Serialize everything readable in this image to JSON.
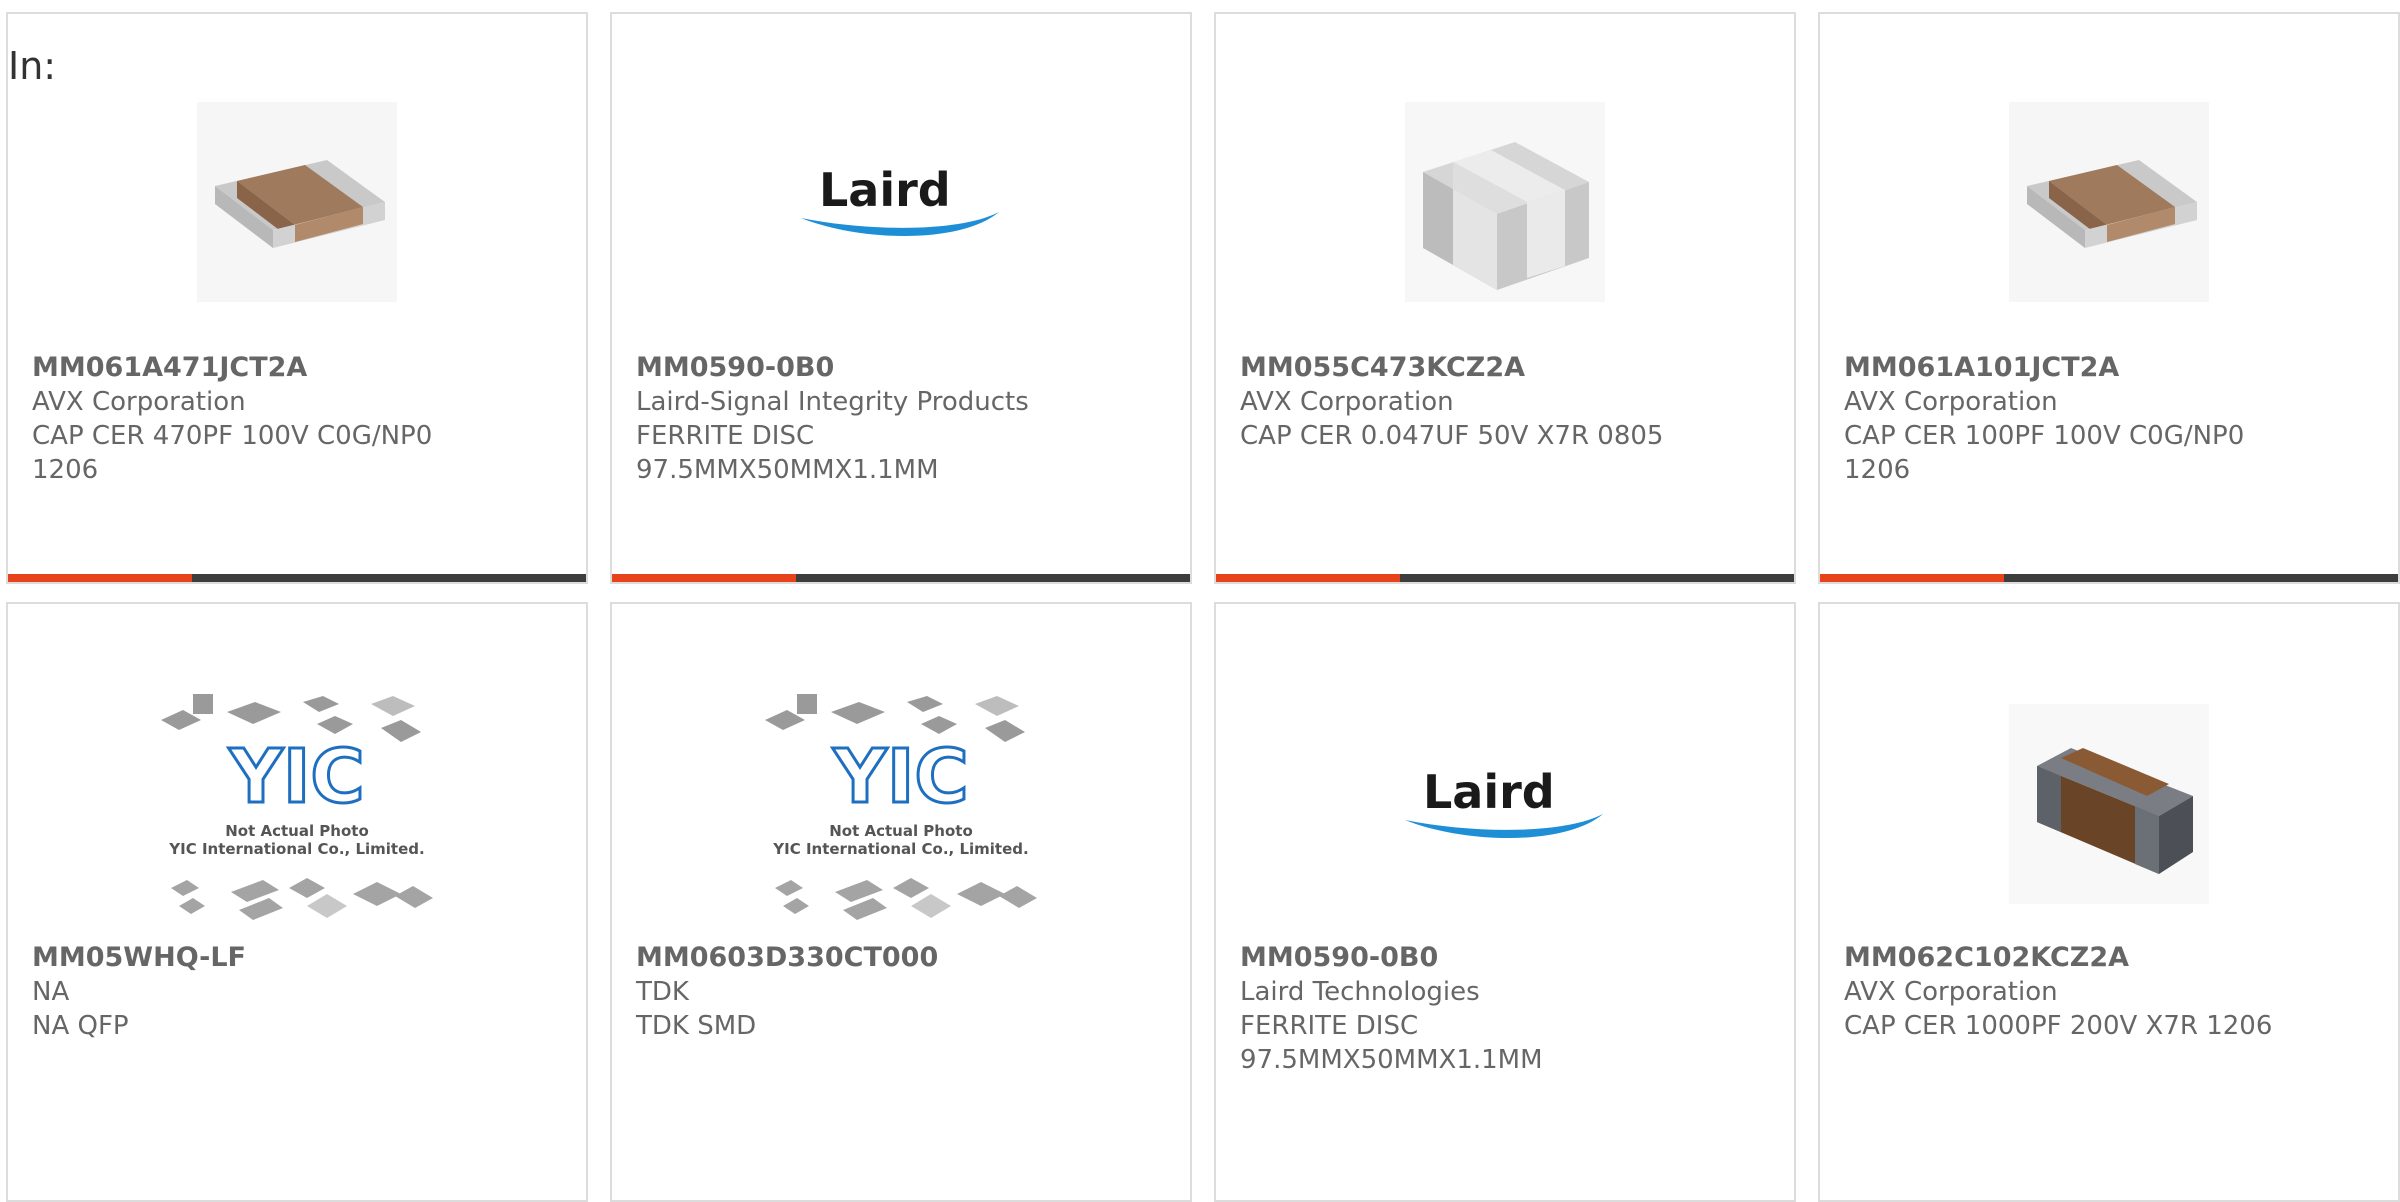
{
  "header": {
    "in_label": "In:"
  },
  "products": [
    {
      "part_number": "MM061A471JCT2A",
      "manufacturer": "AVX Corporation",
      "description_line1": "CAP CER 470PF 100V C0G/NP0",
      "description_line2": "1206",
      "image": "ceramic-capacitor-chip-image"
    },
    {
      "part_number": "MM0590-0B0",
      "manufacturer": "Laird-Signal Integrity Products",
      "description_line1": "FERRITE DISC",
      "description_line2": "97.5MMX50MMX1.1MM",
      "image": "laird-logo"
    },
    {
      "part_number": "MM055C473KCZ2A",
      "manufacturer": "AVX Corporation",
      "description_line1": "CAP CER 0.047UF 50V X7R 0805",
      "description_line2": "",
      "image": "ceramic-capacitor-white-image"
    },
    {
      "part_number": "MM061A101JCT2A",
      "manufacturer": "AVX Corporation",
      "description_line1": "CAP CER 100PF 100V C0G/NP0",
      "description_line2": "1206",
      "image": "ceramic-capacitor-chip-image"
    },
    {
      "part_number": "MM05WHQ-LF",
      "manufacturer": "NA",
      "description_line1": "NA QFP",
      "description_line2": "",
      "image": "yic-placeholder-image"
    },
    {
      "part_number": "MM0603D330CT000",
      "manufacturer": "TDK",
      "description_line1": "TDK SMD",
      "description_line2": "",
      "image": "yic-placeholder-image"
    },
    {
      "part_number": "MM0590-0B0",
      "manufacturer": "Laird Technologies",
      "description_line1": "FERRITE DISC",
      "description_line2": "97.5MMX50MMX1.1MM",
      "image": "laird-logo"
    },
    {
      "part_number": "MM062C102KCZ2A",
      "manufacturer": "AVX Corporation",
      "description_line1": "CAP CER 1000PF 200V X7R 1206",
      "description_line2": "",
      "image": "ceramic-capacitor-dark-image"
    }
  ],
  "image_text": {
    "laird_logo": "Laird",
    "yic_logo": "YIC",
    "yic_caption_line1": "Not Actual Photo",
    "yic_caption_line2": "YIC International Co., Limited."
  },
  "colors": {
    "accent": "#e8421b",
    "bar": "#3d3d3d",
    "card_border": "#dcdcdc",
    "text": "#666666",
    "laird_blue": "#1e8fd6"
  }
}
